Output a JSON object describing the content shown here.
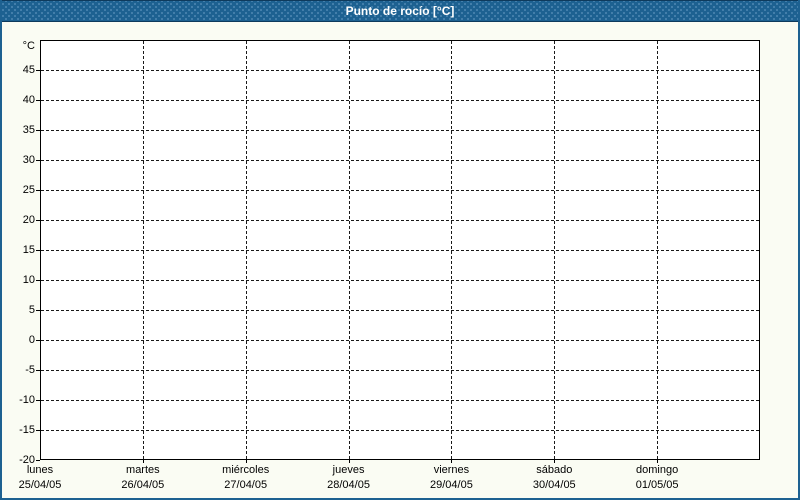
{
  "window": {
    "title": "Punto de rocío [°C]"
  },
  "colors": {
    "titlebar_bg": "#1d6191",
    "titlebar_edge": "#0e3a5c",
    "frame": "#1d6191",
    "window_bg": "#fafcf3",
    "plot_bg": "#ffffff",
    "grid": "#1a1a1a",
    "axis": "#000000",
    "label_text": "#000000",
    "title_text": "#ffffff"
  },
  "chart_data": {
    "type": "line",
    "title": "Punto de rocío [°C]",
    "ylabel": "°C",
    "ylim": [
      -20,
      50
    ],
    "y_tick_step": 5,
    "y_tick_labels": [
      45,
      40,
      35,
      30,
      25,
      20,
      15,
      10,
      5,
      0,
      -5,
      -10,
      -15,
      -20
    ],
    "x_categories": [
      {
        "day": "lunes",
        "date": "25/04/05"
      },
      {
        "day": "martes",
        "date": "26/04/05"
      },
      {
        "day": "miércoles",
        "date": "27/04/05"
      },
      {
        "day": "jueves",
        "date": "28/04/05"
      },
      {
        "day": "viernes",
        "date": "29/04/05"
      },
      {
        "day": "sábado",
        "date": "30/04/05"
      },
      {
        "day": "domingo",
        "date": "01/05/05"
      }
    ],
    "series": [],
    "grid": {
      "horizontal": "dashed",
      "vertical": "dashed"
    },
    "legend": "none"
  }
}
